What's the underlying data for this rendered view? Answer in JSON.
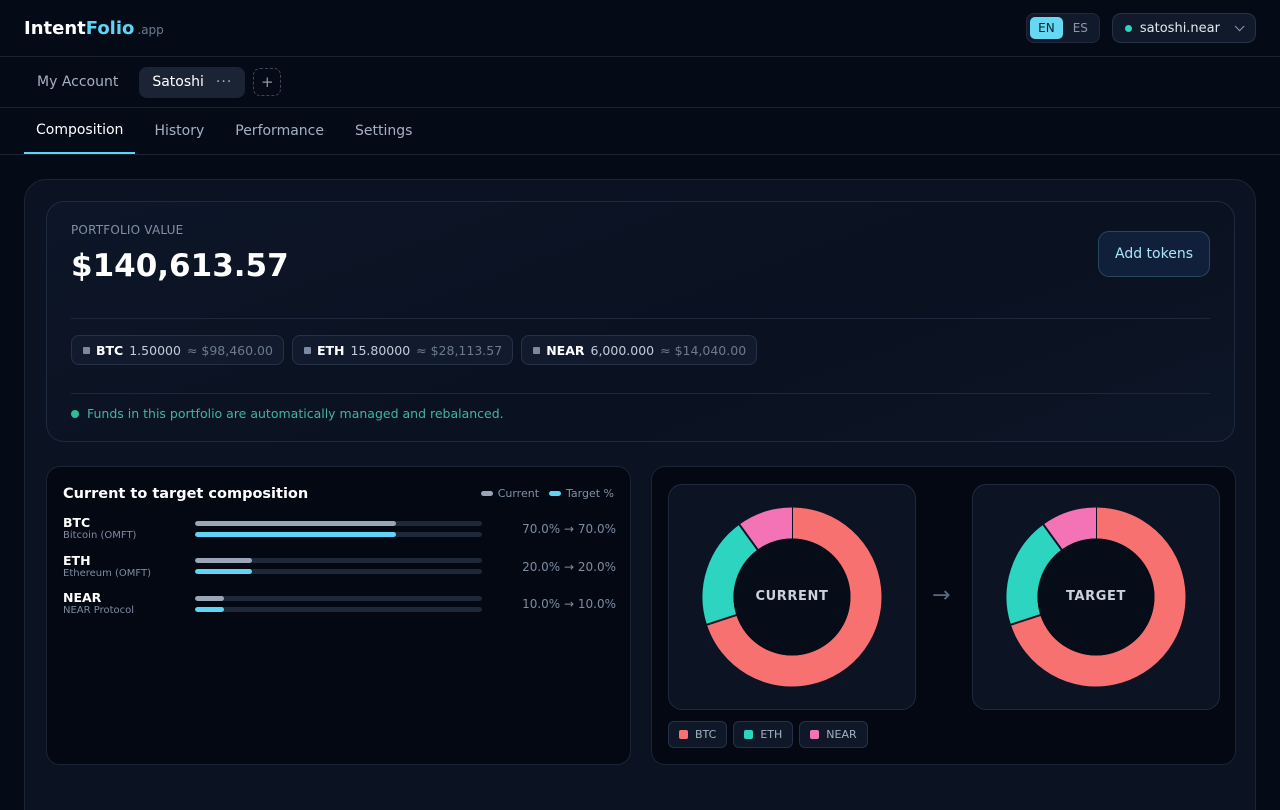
{
  "brand": {
    "name_prefix": "Intent",
    "name_accent": "Folio",
    "tld": ".app"
  },
  "header": {
    "languages": [
      {
        "code": "EN",
        "active": true
      },
      {
        "code": "ES",
        "active": false
      }
    ],
    "account_label": "satoshi.near"
  },
  "accounts": {
    "my_account": "My Account",
    "active_tab": "Satoshi",
    "more_glyph": "···",
    "add_glyph": "+"
  },
  "nav": {
    "tabs": [
      {
        "label": "Composition",
        "active": true
      },
      {
        "label": "History",
        "active": false
      },
      {
        "label": "Performance",
        "active": false
      },
      {
        "label": "Settings",
        "active": false
      }
    ]
  },
  "portfolio": {
    "label": "PORTFOLIO VALUE",
    "value": "$140,613.57",
    "add_tokens": "Add tokens",
    "holdings": [
      {
        "symbol": "BTC",
        "amount": "1.50000",
        "usd": "≈ $98,460.00"
      },
      {
        "symbol": "ETH",
        "amount": "15.80000",
        "usd": "≈ $28,113.57"
      },
      {
        "symbol": "NEAR",
        "amount": "6,000.000",
        "usd": "≈ $14,040.00"
      }
    ],
    "managed_note": "Funds in this portfolio are automatically managed and rebalanced."
  },
  "composition": {
    "title": "Current to target composition",
    "legend_current": "Current",
    "legend_target": "Target %",
    "rows": [
      {
        "symbol": "BTC",
        "name": "Bitcoin (OMFT)",
        "current": 70.0,
        "target": 70.0,
        "pct_text": "70.0% → 70.0%"
      },
      {
        "symbol": "ETH",
        "name": "Ethereum (OMFT)",
        "current": 20.0,
        "target": 20.0,
        "pct_text": "20.0% → 20.0%"
      },
      {
        "symbol": "NEAR",
        "name": "NEAR Protocol",
        "current": 10.0,
        "target": 10.0,
        "pct_text": "10.0% → 10.0%"
      }
    ]
  },
  "donuts": {
    "current_label": "CURRENT",
    "target_label": "TARGET",
    "arrow_glyph": "→",
    "legend": [
      {
        "label": "BTC",
        "color": "#f87171"
      },
      {
        "label": "ETH",
        "color": "#2dd4bf"
      },
      {
        "label": "NEAR",
        "color": "#f472b6"
      }
    ]
  },
  "chart_data": [
    {
      "type": "pie",
      "title": "CURRENT",
      "categories": [
        "BTC",
        "ETH",
        "NEAR"
      ],
      "values": [
        70.0,
        20.0,
        10.0
      ],
      "colors": [
        "#f87171",
        "#2dd4bf",
        "#f472b6"
      ]
    },
    {
      "type": "pie",
      "title": "TARGET",
      "categories": [
        "BTC",
        "ETH",
        "NEAR"
      ],
      "values": [
        70.0,
        20.0,
        10.0
      ],
      "colors": [
        "#f87171",
        "#2dd4bf",
        "#f472b6"
      ]
    }
  ],
  "colors": {
    "accent": "#5fd4f4",
    "success": "#2bbf95",
    "background": "#050a17"
  }
}
